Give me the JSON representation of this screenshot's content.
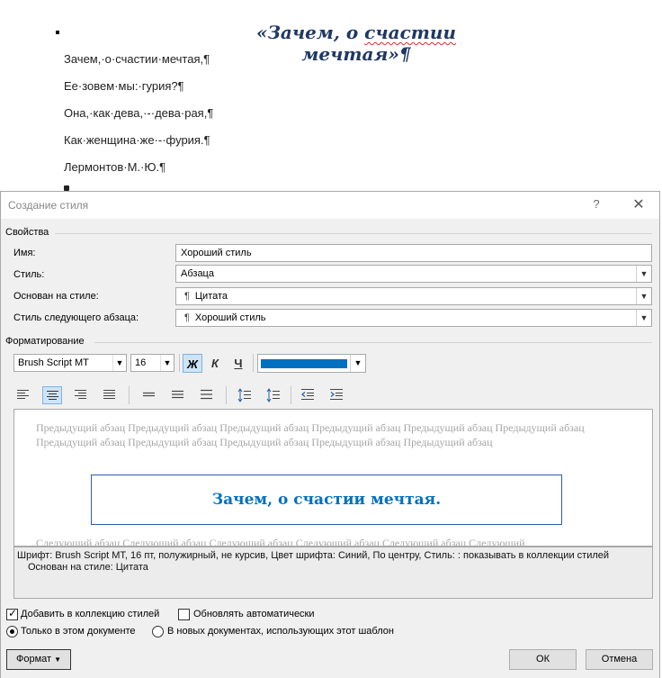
{
  "document": {
    "heading_left": "«Зачем, о ",
    "heading_squig": "счастии",
    "heading_right": " мечтая»",
    "heading_mark": "¶",
    "lines": [
      "Зачем,·о·счастии·мечтая,¶",
      "Ее·зовем·мы:·гурия?¶",
      "Она,·как·дева,·-·дева·рая,¶",
      "Как·женщина·же·-·фурия.¶",
      "Лермонтов·М.·Ю.¶"
    ]
  },
  "dialog": {
    "title": "Создание стиля",
    "help_glyph": "?",
    "close_glyph": "✕",
    "properties": {
      "section": "Свойства",
      "name_label": "Имя:",
      "name_value": "Хороший стиль",
      "style_label": "Стиль:",
      "style_value": "Абзаца",
      "based_label": "Основан на стиле:",
      "based_value": "Цитата",
      "next_label": "Стиль следующего абзаца:",
      "next_value": "Хороший стиль"
    },
    "formatting": {
      "section": "Форматирование",
      "font": "Brush Script MT",
      "size": "16",
      "bold": "Ж",
      "italic": "К",
      "underline": "Ч",
      "color": "#0070c0"
    },
    "preview": {
      "previous": "Предыдущий абзац Предыдущий абзац Предыдущий абзац Предыдущий абзац Предыдущий абзац Предыдущий абзац Предыдущий абзац Предыдущий абзац Предыдущий абзац Предыдущий абзац Предыдущий абзац",
      "sample": "Зачем,  о счастии мечтая.",
      "next": "Следующий абзац Следующий абзац Следующий абзац Следующий абзац Следующий абзац Следующий"
    },
    "description_line1": "Шрифт: Brush Script MT, 16 пт, полужирный, не курсив, Цвет шрифта: Синий, По центру, Стиль: : показывать в коллекции стилей",
    "description_line2": "Основан на стиле: Цитата",
    "options": {
      "add_to_gallery": "Добавить в коллекцию стилей",
      "auto_update": "Обновлять автоматически",
      "only_this_doc": "Только в этом документе",
      "new_docs": "В новых документах, использующих этот шаблон"
    },
    "buttons": {
      "format": "Формат",
      "ok": "ОК",
      "cancel": "Отмена"
    }
  }
}
